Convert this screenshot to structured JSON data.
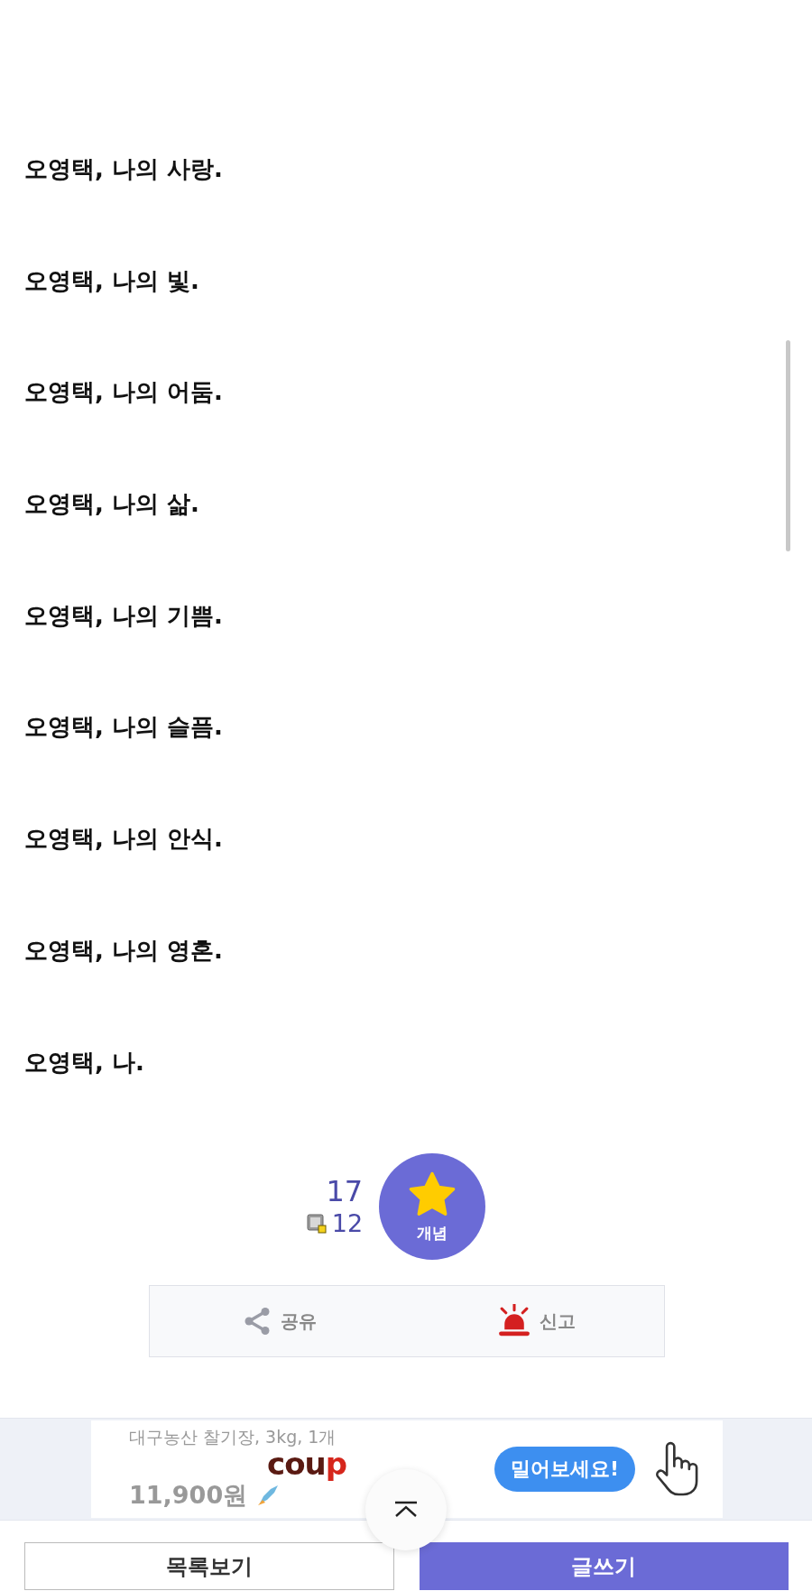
{
  "lines": [
    "오영택, 나의 사랑.",
    "오영택, 나의 빛.",
    "오영택, 나의 어둠.",
    "오영택, 나의 삶.",
    "오영택, 나의 기쁨.",
    "오영택, 나의 슬픔.",
    "오영택, 나의 안식.",
    "오영택, 나의 영혼.",
    "오영택, 나."
  ],
  "vote": {
    "count": "17",
    "sub_count": "12",
    "button_label": "개념"
  },
  "actions": [
    {
      "kind": "share",
      "label": "공유"
    },
    {
      "kind": "report",
      "label": "신고"
    }
  ],
  "ad": {
    "product": "대구농산 찰기장, 3kg, 1개",
    "price": "11,900원",
    "logo": "coup",
    "bubble": "밀어보세요!"
  },
  "buttons": [
    {
      "kind": "secondary",
      "label": "목록보기"
    },
    {
      "kind": "primary",
      "label": "글쓰기"
    }
  ]
}
